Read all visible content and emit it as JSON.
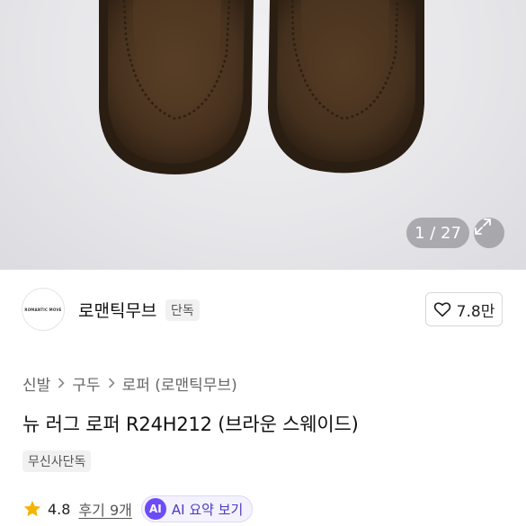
{
  "gallery": {
    "counter": "1 / 27",
    "image": "product-photo-brown-suede-loafers"
  },
  "brand": {
    "avatar_text": "ROMANTIC MOVE",
    "name": "로맨틱무브",
    "exclusive_label": "단독",
    "likes": "7.8만"
  },
  "breadcrumb": [
    "신발",
    "구두",
    "로퍼 (로맨틱무브)"
  ],
  "product": {
    "title": "뉴 러그 로퍼 R24H212 (브라운 스웨이드)",
    "store_badge": "무신사단독"
  },
  "rating": {
    "score": "4.8",
    "review_label": "후기 9개",
    "ai_badge": "AI",
    "ai_label": "AI 요약 보기"
  },
  "colors": {
    "star": "#f5b400",
    "ai_accent": "#6d4bf6",
    "suede": "#4a3320"
  }
}
